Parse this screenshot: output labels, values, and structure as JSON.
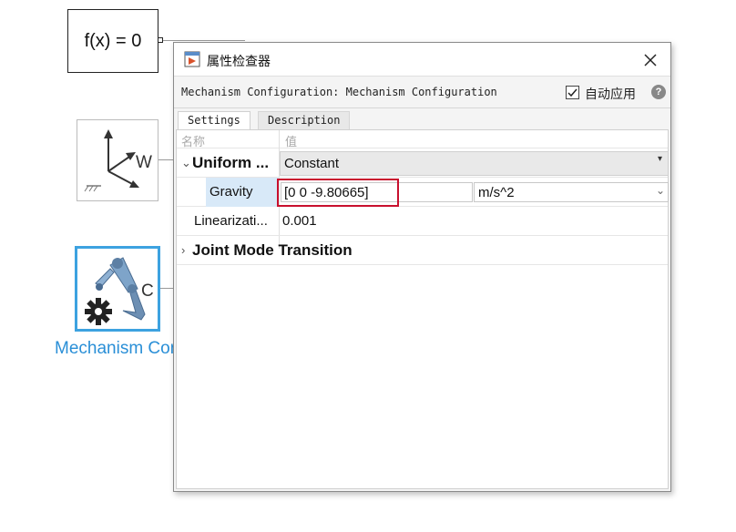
{
  "canvas": {
    "fx_block": {
      "label": "f(x) = 0"
    },
    "frame_block": {
      "port_label": "W"
    },
    "mechanism_block": {
      "port_label": "C",
      "label": "Mechanism Configuration"
    }
  },
  "dialog": {
    "title": "属性检查器",
    "subheader": "Mechanism Configuration: Mechanism Configuration",
    "auto_apply": {
      "label": "自动应用",
      "checked": true
    },
    "tabs": [
      {
        "label": "Settings",
        "active": true
      },
      {
        "label": "Description",
        "active": false
      }
    ],
    "columns": {
      "name": "名称",
      "value": "值"
    },
    "rows": {
      "uniform": {
        "name": "Uniform ...",
        "value": "Constant",
        "expanded": true
      },
      "gravity": {
        "name": "Gravity",
        "value": "[0 0 -9.80665]",
        "unit": "m/s^2"
      },
      "linearization": {
        "name": "Linearizati...",
        "value": "0.001"
      },
      "joint_mode": {
        "name": "Joint Mode Transition",
        "expanded": false
      }
    }
  },
  "colors": {
    "selection_blue": "#3da2e0",
    "highlight_red": "#c8102e",
    "row_selected": "#d8e9f8"
  }
}
